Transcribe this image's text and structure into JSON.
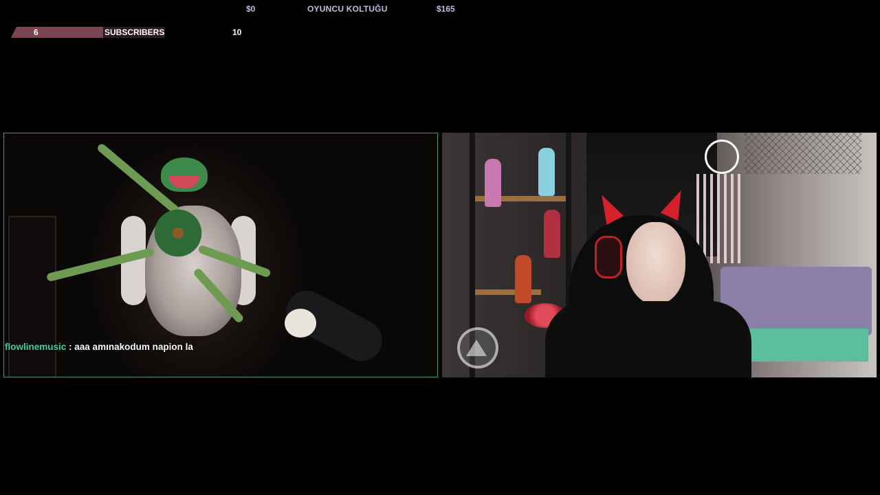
{
  "goal": {
    "start": "$0",
    "title": "OYUNCU KOLTUĞU",
    "end": "$165"
  },
  "subscribers": {
    "current": "6",
    "label": "SUBSCRIBERS",
    "goal": "10",
    "progress_fraction": 0.6
  },
  "chat": {
    "username": "flowlinemusic",
    "separator": " : ",
    "message": "aaa amınakodum napion la"
  },
  "colors": {
    "left_cam_border": "#4a9a6a",
    "chat_username": "#39d4a0",
    "sub_fill": "#7a4550",
    "goal_text": "#c8b8e0"
  }
}
